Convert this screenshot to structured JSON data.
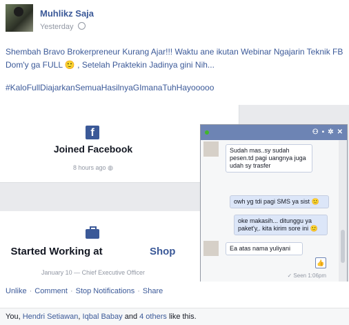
{
  "post": {
    "author": "Muhlikz Saja",
    "time": "Yesterday",
    "text": "Shembah Bravo Brokerpreneur Kurang Ajar!!! Waktu ane ikutan Webinar Ngajarin Teknik FB Dom'y ga FULL 🙂 , Setelah Praktekin Jadinya gini Nih...",
    "hashtag": "#KaloFullDiajarkanSemuaHasilnyaGImanaTuhHayooooo"
  },
  "screenshot": {
    "card1": {
      "title": "Joined Facebook",
      "subtitle": "8 hours ago",
      "icon": "facebook-icon"
    },
    "card2": {
      "title_prefix": "Started Working at",
      "title_suffix": "Shop",
      "subtitle": "January 10 — Chief Executive Officer",
      "icon": "briefcase-icon"
    },
    "chat": {
      "header_name": "",
      "messages": [
        {
          "from": "them",
          "text": "Sudah mas..sy sudah pesen.td pagi uangnya juga udah sy trasfer"
        },
        {
          "from": "me",
          "text": "owh yg tdi pagi SMS ya sist 🙂"
        },
        {
          "from": "me",
          "text": "oke makasih... ditunggu ya paket'y,. kita kirim sore ini 🙂"
        },
        {
          "from": "them",
          "text": "Ea atas nama yuliyani"
        }
      ],
      "seen": "✓ Seen 1:06pm"
    }
  },
  "actions": {
    "unlike": "Unlike",
    "comment": "Comment",
    "stop_notifications": "Stop Notifications",
    "share": "Share",
    "sep": "·"
  },
  "likes": {
    "you": "You,",
    "name1": "Hendri Setiawan",
    "name2": "Iqbal Babay",
    "and": "and",
    "others": "4 others",
    "suffix": "like this."
  },
  "colors": {
    "link": "#3b5998",
    "chat_header": "#6d84b4"
  }
}
